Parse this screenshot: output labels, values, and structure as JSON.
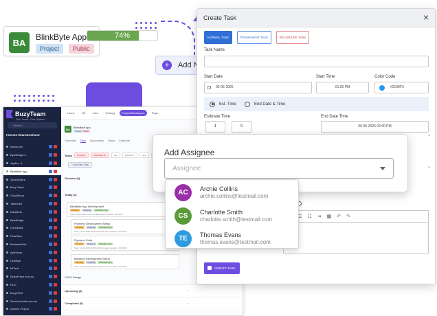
{
  "project_card": {
    "avatar": "BA",
    "name": "BlinkByte App",
    "tag_project": "Project",
    "tag_public": "Public",
    "progress_label": "74%",
    "progress_value": 0.74,
    "avatar_color": "#3a8a3a",
    "progress_color": "#6aa64f"
  },
  "add_new_task": {
    "label": "Add New Task",
    "icon": "plus-circle-icon"
  },
  "app": {
    "brand": "BuzyTeam",
    "brand_sub": "One Team, One System",
    "search_placeholder": "Search...",
    "sidebar_heading": "PROJECTS/WORKSPACE",
    "sidebar_items": [
      "NovaCore",
      "ByteBridge-1",
      "Jupiter - 1",
      "BlinkByte App",
      "SyncSphere",
      "Buzy Team",
      "CloudNova",
      "TaskOrbit",
      "DataNest",
      "ByteBridge",
      "CoreStack",
      "FlowSync",
      "BusinessSoft",
      "AppVerse",
      "LinkByte",
      "MiTech",
      "EpikoFresh.com.au",
      "ROC",
      "BuzyCRM",
      "ServiceHands.com.au",
      "Archive Project"
    ],
    "active_index": 3,
    "topnav": [
      "Home",
      "HR",
      "Jobs",
      "Training",
      "Project/Workspace",
      "Repo"
    ],
    "topnav_active": 4,
    "ws_avatar": "BA",
    "ws_title": "BlinkByte App",
    "ws_tag_project": "Project",
    "ws_tag_public": "Public",
    "subtabs": [
      "Overview",
      "Task",
      "Documents",
      "Team",
      "Calendar"
    ],
    "subtab_active": 1,
    "filters_label": "Tasks",
    "filters": [
      "NORMAL",
      "CREATED BY",
      "ALL",
      "PRIORITY",
      "ALL",
      "LIST VIEW"
    ],
    "add_task_mini": "+ Add New Task",
    "overdue_label": "Overdue (0)",
    "today_label": "Today (2)",
    "tasks": [
      {
        "title": "BlinkByte App Development",
        "chip1": "Pending",
        "chip2": "Ongoing",
        "chip3": "BlinkByte App",
        "meta": "Start: 10-05-2026 00:00 AM  Estimated Duration: 00:00:00"
      },
      {
        "title": "Frontend Development Setup",
        "chip1": "Pending",
        "chip2": "Ongoing",
        "chip3": "BlinkByte App",
        "meta": "Start: 11-05-2026 00:00 AM  Estimated Duration: 00:00:00"
      },
      {
        "title": "Figma to Code",
        "chip1": "Pending",
        "chip2": "Ongoing",
        "chip3": "BlinkByte App",
        "meta": "Start: 12-05-2026 00:00 AM  Estimated Duration: 00:00:00"
      },
      {
        "title": "Backend Development Setup",
        "chip1": "Pending",
        "chip2": "Ongoing",
        "chip3": "BlinkByte App",
        "meta": "Start: 13-05-2026 00:00 AM  Estimated Duration: 00:00:00"
      }
    ],
    "ui_ux_label": "UI/UX Design",
    "upcoming_label": "Upcoming (4)",
    "completed_label": "Completed (0)"
  },
  "modal": {
    "title": "Create Task",
    "close": "×",
    "type_normal": "NORMAL TASK",
    "type_permanent": "PERMANENT TASK",
    "type_recursive": "RECURSIVE TASK",
    "task_name_label": "Task Name",
    "start_date_label": "Start Date",
    "start_date_value": "06-05-2026",
    "start_time_label": "Start Time",
    "start_time_value": "01:00 PM",
    "color_code_label": "Color Code",
    "color_code_value": "#2199F3",
    "color_code_hex": "#2199f3",
    "radio_est": "Est. Time",
    "radio_end": "End Date & Time",
    "estimate_label": "Estimate Time",
    "estimate_hours": "1",
    "estimate_minutes": "0",
    "estimate_sep": ":",
    "end_date_label": "End Date Time",
    "end_date_value": "06-05-2026 02:00 PM",
    "create_label": "CREATE TASK",
    "accent": "#6c4de0"
  },
  "assignee": {
    "title": "Add Assignee",
    "placeholder": "Assignee",
    "options": [
      {
        "initials": "AC",
        "name": "Archie Collins",
        "email": "archie.collins@testmail.com",
        "color": "#9b2fa8"
      },
      {
        "initials": "CS",
        "name": "Charlotte Smith",
        "email": "charlotte.smith@testmail.com",
        "color": "#5a9a3a"
      },
      {
        "initials": "TE",
        "name": "Thomas Evans",
        "email": "thomas.evans@testmail.com",
        "color": "#2e9be0"
      }
    ]
  }
}
